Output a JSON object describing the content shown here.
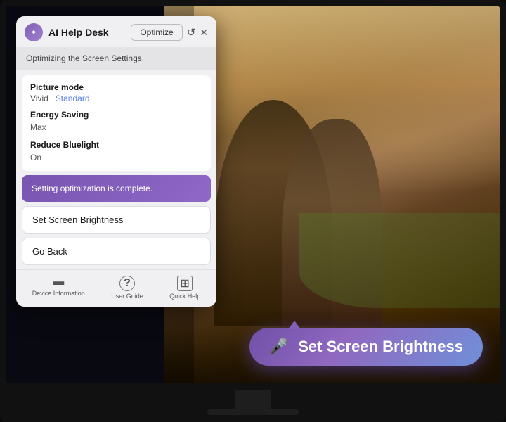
{
  "app": {
    "title": "AI Help Desk",
    "optimize_label": "Optimize",
    "subheader": "Optimizing the Screen Settings.",
    "settings": [
      {
        "label": "Picture mode",
        "values": [
          {
            "text": "Vivid",
            "active": false
          },
          {
            "text": "Standard",
            "active": true
          }
        ]
      },
      {
        "label": "Energy Saving",
        "values": [
          {
            "text": "Max",
            "active": false
          }
        ]
      },
      {
        "label": "Reduce Bluelight",
        "values": [
          {
            "text": "On",
            "active": false
          }
        ]
      }
    ],
    "completion_text": "Setting optimization is complete.",
    "action_buttons": [
      {
        "label": "Set Screen Brightness"
      },
      {
        "label": "Go Back"
      }
    ],
    "footer_items": [
      {
        "icon": "▭",
        "label": "Device Information"
      },
      {
        "icon": "?",
        "label": "User Guide"
      },
      {
        "icon": "⊡",
        "label": "Quick Help"
      }
    ]
  },
  "voice_bubble": {
    "text": "Set Screen Brightness",
    "mic_symbol": "🎤"
  },
  "icons": {
    "ai_icon": "🤖",
    "reset_icon": "↺",
    "close_icon": "✕"
  }
}
